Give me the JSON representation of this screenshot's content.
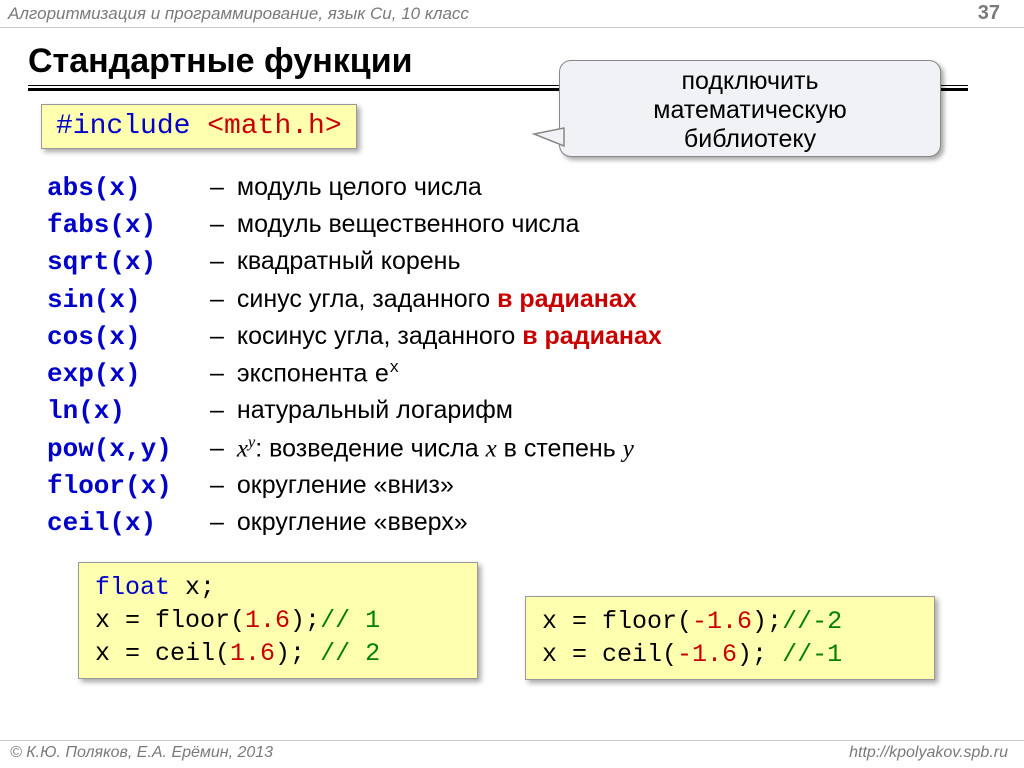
{
  "header": {
    "course": "Алгоритмизация и программирование, язык Си, 10 класс",
    "page": "37"
  },
  "title": "Стандартные функции",
  "callout": {
    "line1": "подключить",
    "line2": "математическую",
    "line3": "библиотеку"
  },
  "include": {
    "directive": "#include",
    "header": "<math.h>"
  },
  "funcs": [
    {
      "sig": "abs(x)",
      "desc": "модуль целого числа"
    },
    {
      "sig": "fabs(x)",
      "desc": "модуль вещественного числа"
    },
    {
      "sig": "sqrt(x)",
      "desc": "квадратный корень"
    },
    {
      "sig": "sin(x)",
      "desc": "синус угла, заданного ",
      "emph": "в радианах"
    },
    {
      "sig": "cos(x)",
      "desc": "косинус угла, заданного ",
      "emph": "в радианах"
    },
    {
      "sig": "exp(x)",
      "desc_pre": "экспонента ",
      "mono": "e",
      "sup": "x"
    },
    {
      "sig": "ln(x)",
      "desc": "натуральный логарифм"
    },
    {
      "sig": "pow(x,y)",
      "ital_base": "x",
      "ital_sup": "y",
      "desc2": ": возведение числа ",
      "ital_x": "x",
      "desc3": " в степень ",
      "ital_y": "y"
    },
    {
      "sig": "floor(x)",
      "desc": "округление «вниз»"
    },
    {
      "sig": "ceil(x)",
      "desc": "округление «вверх»"
    }
  ],
  "code_left": {
    "l1_type": "float",
    "l1_rest": " x;",
    "l2_a": "x = floor(",
    "l2_n": "1.6",
    "l2_b": ");",
    "l2_c": "// 1",
    "l3_a": "x = ceil(",
    "l3_n": "1.6",
    "l3_b": "); ",
    "l3_c": "// 2"
  },
  "code_right": {
    "l1_a": "x = floor(",
    "l1_n": "-1.6",
    "l1_b": ");",
    "l1_c": "//-2",
    "l2_a": "x = ceil(",
    "l2_n": "-1.6",
    "l2_b": "); ",
    "l2_c": "//-1"
  },
  "footer": {
    "copyright": "© К.Ю. Поляков, Е.А. Ерёмин, 2013",
    "url": "http://kpolyakov.spb.ru"
  },
  "dash": "–"
}
